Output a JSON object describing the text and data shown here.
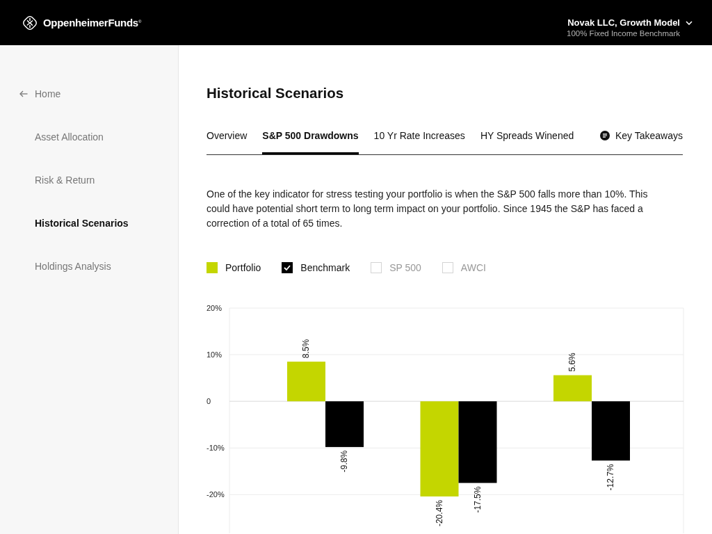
{
  "header": {
    "brand": "OppenheimerFunds$^{®}$",
    "account": {
      "title": "Novak LLC, Growth Model",
      "subtitle": "100% Fixed Income Benchmark"
    }
  },
  "sidebar": {
    "back_link": "Home",
    "items": [
      {
        "label": "Asset Allocation",
        "selected": false
      },
      {
        "label": "Risk & Return",
        "selected": false
      },
      {
        "label": "Historical Scenarios",
        "selected": true
      },
      {
        "label": "Holdings Analysis",
        "selected": false
      }
    ]
  },
  "page": {
    "title": "Historical Scenarios",
    "tabs": [
      {
        "label": "Overview",
        "selected": false
      },
      {
        "label": "S&P 500 Drawdowns",
        "selected": true
      },
      {
        "label": "10 Yr Rate Increases",
        "selected": false
      },
      {
        "label": "HY Spreads Winened",
        "selected": false
      }
    ],
    "takeaways_link": "Key Takeaways",
    "description": "One of the key indicator for stress testing your portfolio is when the S&P 500 falls more than 10%. This could have potential short term to long term impact on your portfolio. Since 1945 the S&P has faced a correction of a total of 65 times.",
    "legend": [
      {
        "kind": "swatch",
        "label": "Portfolio",
        "color": "#c4d600"
      },
      {
        "kind": "checkbox",
        "label": "Benchmark",
        "checked": true,
        "color": "#000000"
      },
      {
        "kind": "checkbox",
        "label": "SP 500",
        "checked": false
      },
      {
        "kind": "checkbox",
        "label": "AWCI",
        "checked": false
      }
    ],
    "chart_data": {
      "type": "bar",
      "grid": true,
      "series": [
        {
          "color": "#c4d600",
          "values": [
            8.5,
            -20.4,
            5.6
          ]
        },
        {
          "color": "#000000",
          "values": [
            -9.8,
            -17.5,
            -12.7
          ]
        }
      ],
      "ylim": [
        -28,
        20
      ],
      "yticks": [
        {
          "value": 20,
          "label": "20%"
        },
        {
          "value": 10,
          "label": "10%"
        },
        {
          "value": 0,
          "label": "0"
        },
        {
          "value": -10,
          "label": "-10%"
        },
        {
          "value": -20,
          "label": "-20%"
        }
      ],
      "value_labels": [
        [
          "8.5%",
          "-20.4%",
          "5.6%"
        ],
        [
          "-9.8%",
          "-17.5%",
          "-12.7%"
        ]
      ]
    }
  }
}
